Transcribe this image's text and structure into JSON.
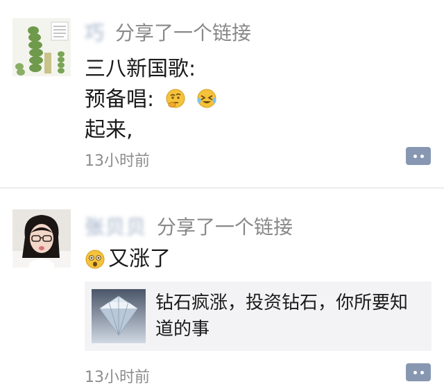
{
  "posts": [
    {
      "username": "巧",
      "action": "分享了一个链接",
      "lines": [
        "三八新国歌:",
        "预备唱:",
        "起来,"
      ],
      "emojis": [
        "thinking-face-emoji",
        "laughing-tears-emoji"
      ],
      "time": "13小时前",
      "comment_icon": "comment-icon"
    },
    {
      "username": "张贝贝",
      "action": "分享了一个链接",
      "text": "又涨了",
      "emojis": [
        "astonished-face-emoji"
      ],
      "link": {
        "title": "钻石疯涨，投资钻石，你所要知道的事",
        "thumb_icon": "diamond-icon"
      },
      "time": "13小时前",
      "comment_icon": "comment-icon"
    }
  ],
  "colors": {
    "username": "#b7c3d4",
    "action": "#888888",
    "time": "#8c8c8c",
    "comment_button": "#8897b1",
    "link_card_bg": "#f3f3f5"
  }
}
